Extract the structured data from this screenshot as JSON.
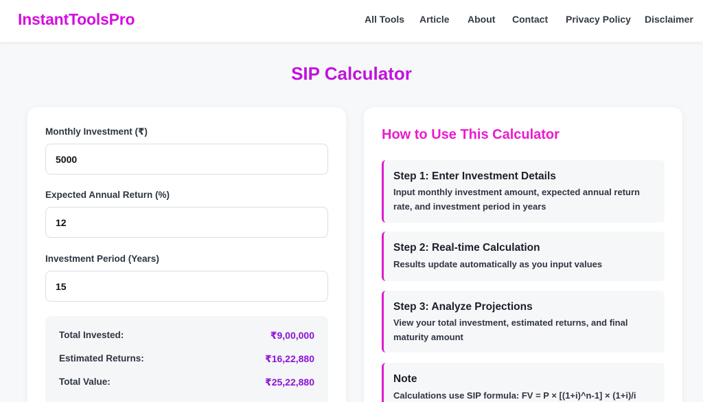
{
  "brand": {
    "name": "InstantToolsPro",
    "color": "#d40ee0"
  },
  "nav": {
    "items": [
      {
        "label": "All Tools"
      },
      {
        "label": "Article"
      },
      {
        "label": "About"
      },
      {
        "label": "Contact"
      },
      {
        "label": "Privacy Policy"
      },
      {
        "label": "Disclaimer"
      }
    ]
  },
  "page": {
    "title": "SIP Calculator"
  },
  "calculator": {
    "monthly_label": "Monthly Investment (₹)",
    "monthly_value": "5000",
    "return_label": "Expected Annual Return (%)",
    "return_value": "12",
    "period_label": "Investment Period (Years)",
    "period_value": "15"
  },
  "results": {
    "invested_label": "Total Invested:",
    "invested_value": "₹9,00,000",
    "returns_label": "Estimated Returns:",
    "returns_value": "₹16,22,880",
    "total_label": "Total Value:",
    "total_value": "₹25,22,880"
  },
  "howto": {
    "title": "How to Use This Calculator",
    "steps": [
      {
        "title": "Step 1: Enter Investment Details",
        "text": "Input monthly investment amount, expected annual return rate, and investment period in years"
      },
      {
        "title": "Step 2: Real-time Calculation",
        "text": "Results update automatically as you input values"
      },
      {
        "title": "Step 3: Analyze Projections",
        "text": "View your total investment, estimated returns, and final maturity amount"
      },
      {
        "title": "Note",
        "text": "Calculations use SIP formula: FV = P × [(1+i)^n-1] × (1+i)/i"
      }
    ]
  },
  "colors": {
    "accent": "#c113dc",
    "step_border": "#e01bd0",
    "value": "#8b12d8"
  }
}
